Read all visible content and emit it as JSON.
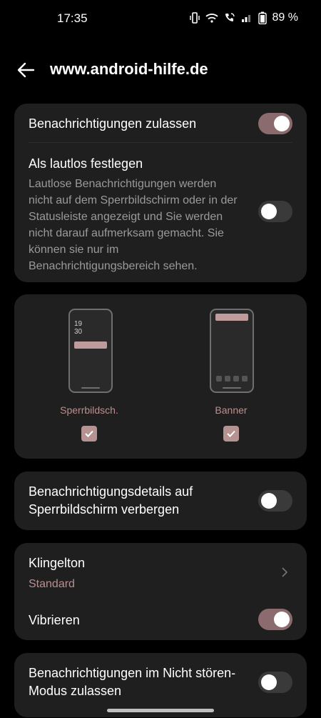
{
  "status_bar": {
    "time": "17:35",
    "battery_percent": "89 %",
    "icons": [
      "vibrate-icon",
      "wifi-icon",
      "wifi-calling-icon",
      "signal-icon",
      "battery-icon"
    ]
  },
  "header": {
    "title": "www.android-hilfe.de",
    "back_icon": "arrow-left-icon"
  },
  "card1": {
    "allow_label": "Benachrichtigungen zulassen",
    "allow_on": true,
    "silent_title": "Als lautlos festlegen",
    "silent_desc": "Lautlose Benachrichtigungen werden nicht auf dem Sperrbildschirm oder in der Statusleiste angezeigt und Sie werden nicht darauf aufmerksam gemacht. Sie können sie nur im Benachrichtigungsbereich sehen.",
    "silent_on": false
  },
  "styles": {
    "lockscreen": {
      "label": "Sperrbildsch.",
      "checked": true,
      "clock_hour": "19",
      "clock_min": "30"
    },
    "banner": {
      "label": "Banner",
      "checked": true
    }
  },
  "details": {
    "label": "Benachrichtigungsdetails auf Sperrbildschirm verbergen",
    "on": false
  },
  "sound": {
    "ringtone_label": "Klingelton",
    "ringtone_value": "Standard",
    "vibrate_label": "Vibrieren",
    "vibrate_on": true
  },
  "dnd": {
    "label": "Benachrichtigungen im Nicht stören-Modus zulassen",
    "on": false
  },
  "colors": {
    "accent": "#8b6b6d",
    "card": "#1f1f1f",
    "background": "#000000"
  }
}
